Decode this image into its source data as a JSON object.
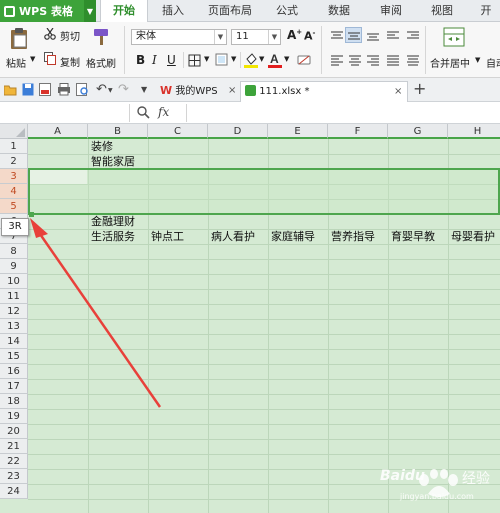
{
  "app": {
    "name": "WPS 表格"
  },
  "menu_tabs": [
    "开始",
    "插入",
    "页面布局",
    "公式",
    "数据",
    "审阅",
    "视图",
    "开"
  ],
  "ribbon": {
    "paste": "粘贴",
    "cut": "剪切",
    "copy": "复制",
    "format_painter": "格式刷",
    "font_name": "宋体",
    "font_size": "11",
    "merge_center": "合并居中",
    "auto_wrap": "自动"
  },
  "doc_tabs": [
    {
      "label": "我的WPS",
      "close": "×"
    },
    {
      "label": "111.xlsx *",
      "close": "×"
    }
  ],
  "new_tab": "+",
  "formula_bar": {
    "fx": "fx",
    "name_box": "",
    "value": ""
  },
  "columns": [
    "A",
    "B",
    "C",
    "D",
    "E",
    "F",
    "G",
    "H"
  ],
  "rows": [
    "1",
    "2",
    "3",
    "4",
    "5",
    "6",
    "7",
    "8",
    "9",
    "10",
    "11",
    "12",
    "13",
    "14",
    "15",
    "16",
    "17",
    "18",
    "19",
    "20",
    "21",
    "22",
    "23",
    "24"
  ],
  "cells": {
    "b1": "装修",
    "b2": "智能家居",
    "b6": "金融理财",
    "b7": "生活服务",
    "c7": "钟点工",
    "d7": "病人看护",
    "e7": "家庭辅导",
    "f7": "营养指导",
    "g7": "育婴早教",
    "h7": "母婴看护"
  },
  "selection_tooltip": "3R",
  "watermark": {
    "brand": "Baidu",
    "text": "经验",
    "url": "jingyan.baidu.com"
  },
  "colors": {
    "accent": "#3da33a",
    "selection": "#4ea64e",
    "arrow": "#e8403a",
    "grid_bg": "#d5ead3"
  }
}
